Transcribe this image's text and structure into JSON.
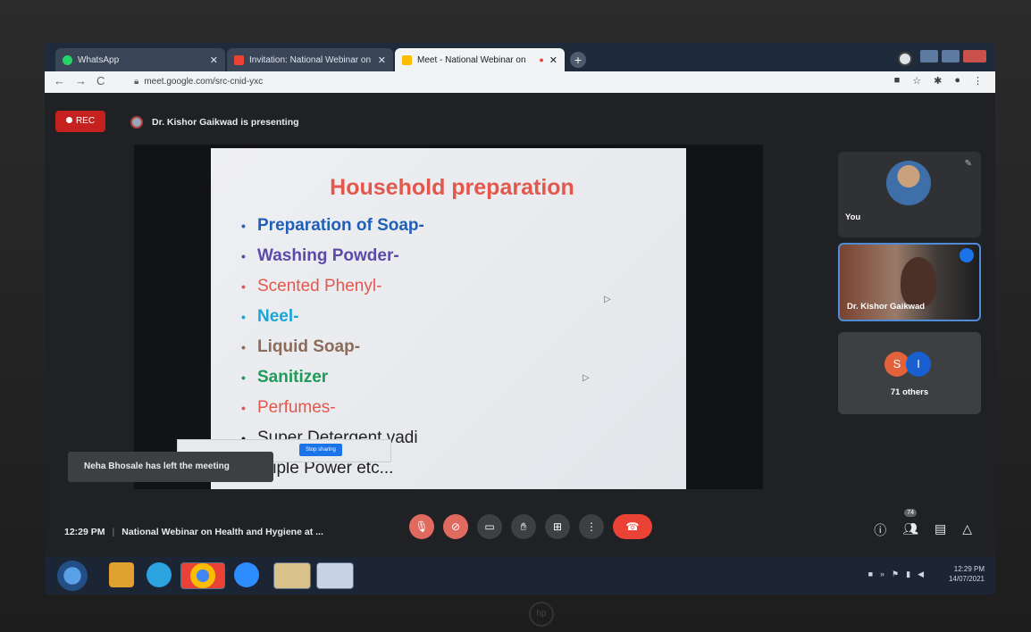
{
  "browser": {
    "tabs": [
      {
        "label": "WhatsApp",
        "icon": "whatsapp-icon",
        "color": "#25d366"
      },
      {
        "label": "Invitation: National Webinar on …",
        "icon": "gmail-icon",
        "color": "#ea4335"
      },
      {
        "label": "Meet - National Webinar on",
        "icon": "meet-icon",
        "color": "#fbbc04"
      }
    ],
    "url": "meet.google.com/src-cnid-yxc"
  },
  "meeting": {
    "rec_label": "REC",
    "presenting_text": "Dr. Kishor Gaikwad is presenting",
    "time": "12:29 PM",
    "title": "National Webinar on Health and Hygiene at ..."
  },
  "slide": {
    "title": "Household preparation",
    "bullets": [
      {
        "text": "Preparation of Soap-",
        "color": "#1f5fb8"
      },
      {
        "text": "Washing Powder-",
        "color": "#5c4aa8"
      },
      {
        "text": "Scented Phenyl-",
        "color": "#e4574d"
      },
      {
        "text": "Neel-",
        "color": "#1aa6d6"
      },
      {
        "text": "Liquid Soap-",
        "color": "#8c6b5a"
      },
      {
        "text": "Sanitizer",
        "color": "#1f9a58"
      },
      {
        "text": "Perfumes-",
        "color": "#e4574d"
      },
      {
        "text": "Super Detergent vadi",
        "color": "#222222"
      },
      {
        "text": "Triple Power etc...",
        "color": "#222222"
      }
    ],
    "stop_sharing_label": "Stop sharing"
  },
  "participants": {
    "you_label": "You",
    "speaker_label": "Dr. Kishor Gaikwad",
    "others_initials": [
      "S",
      "I"
    ],
    "others_label": "71 others",
    "people_count": "74"
  },
  "toast": "Neha Bhosale has left the meeting",
  "taskbar": {
    "time": "12:29 PM",
    "date": "14/07/2021"
  }
}
